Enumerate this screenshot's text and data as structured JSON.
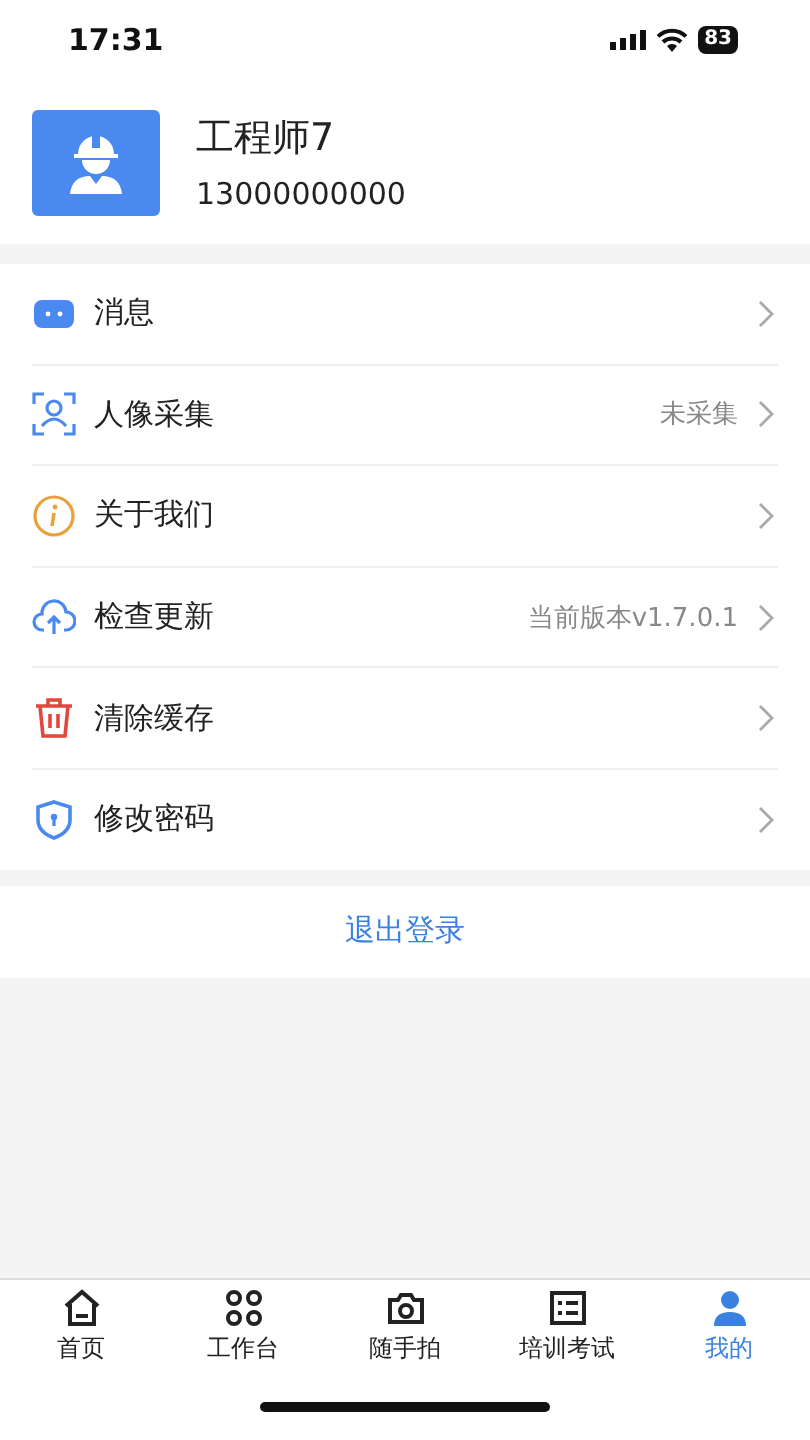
{
  "status_bar": {
    "time": "17:31",
    "battery": "83"
  },
  "profile": {
    "name": "工程师7",
    "phone": "13000000000"
  },
  "menu": [
    {
      "kind": "message",
      "label": "消息"
    },
    {
      "kind": "face",
      "label": "人像采集",
      "value": "未采集"
    },
    {
      "kind": "info",
      "label": "关于我们"
    },
    {
      "kind": "update",
      "label": "检查更新",
      "value": "当前版本v1.7.0.1"
    },
    {
      "kind": "trash",
      "label": "清除缓存"
    },
    {
      "kind": "shield",
      "label": "修改密码"
    }
  ],
  "logout": "退出登录",
  "tabs": [
    {
      "kind": "home",
      "label": "首页",
      "selected": false
    },
    {
      "kind": "grid",
      "label": "工作台",
      "selected": false
    },
    {
      "kind": "camera",
      "label": "随手拍",
      "selected": false
    },
    {
      "kind": "list",
      "label": "培训考试",
      "selected": false
    },
    {
      "kind": "user",
      "label": "我的",
      "selected": true
    }
  ]
}
